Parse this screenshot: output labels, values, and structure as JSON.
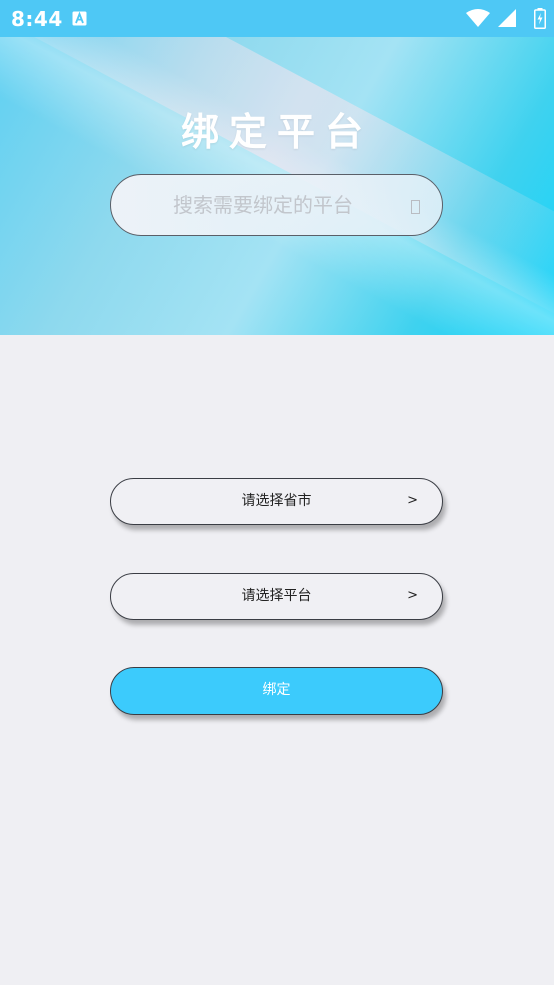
{
  "status_bar": {
    "time": "8:44",
    "notification_icon": "font-a-icon",
    "icons": [
      "wifi-icon",
      "signal-icon",
      "battery-charging-icon"
    ]
  },
  "header": {
    "title": "绑定平台",
    "search": {
      "placeholder": "搜索需要绑定的平台",
      "value": "",
      "icon": "search-icon"
    }
  },
  "form": {
    "province_select_label": "请选择省市",
    "province_chevron": ">",
    "platform_select_label": "请选择平台",
    "platform_chevron": ">",
    "bind_button_label": "绑定"
  },
  "colors": {
    "status_bar": "#4ec8f5",
    "accent": "#3ccbfc",
    "background": "#efeff3"
  }
}
